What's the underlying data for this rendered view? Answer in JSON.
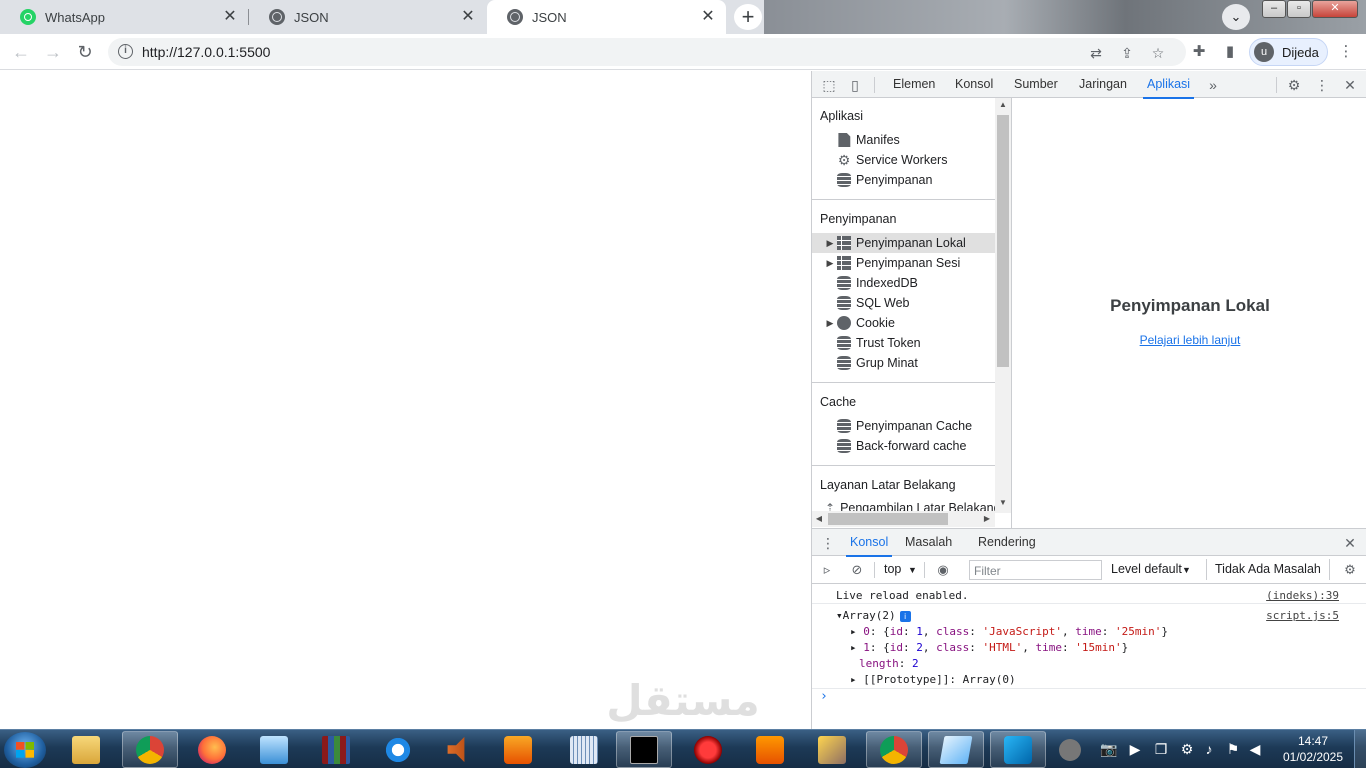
{
  "browser": {
    "tabs": [
      {
        "title": "WhatsApp",
        "favicon": "whatsapp-icon"
      },
      {
        "title": "JSON",
        "favicon": "globe-icon"
      },
      {
        "title": "JSON",
        "favicon": "globe-icon",
        "active": true
      }
    ],
    "url": "http://127.0.0.1:5500",
    "profile_initial": "u",
    "profile_name": "Dijeda"
  },
  "devtools": {
    "tabs": [
      "Elemen",
      "Konsol",
      "Sumber",
      "Jaringan",
      "Aplikasi"
    ],
    "active_tab": "Aplikasi",
    "sidebar": {
      "aplikasi": {
        "heading": "Aplikasi",
        "items": [
          "Manifes",
          "Service Workers",
          "Penyimpanan"
        ]
      },
      "penyimpanan": {
        "heading": "Penyimpanan",
        "items": [
          "Penyimpanan Lokal",
          "Penyimpanan Sesi",
          "IndexedDB",
          "SQL Web",
          "Cookie",
          "Trust Token",
          "Grup Minat"
        ]
      },
      "cache": {
        "heading": "Cache",
        "items": [
          "Penyimpanan Cache",
          "Back-forward cache"
        ]
      },
      "layanan": {
        "heading": "Layanan Latar Belakang",
        "items": [
          "Pengambilan Latar Belakang"
        ]
      }
    },
    "main": {
      "title": "Penyimpanan Lokal",
      "link": "Pelajari lebih lanjut"
    },
    "drawer": {
      "tabs": [
        "Konsol",
        "Masalah",
        "Rendering"
      ],
      "active_tab": "Konsol",
      "context": "top",
      "filter_placeholder": "Filter",
      "level": "Level default",
      "issues": "Tidak Ada Masalah",
      "messages": {
        "live_reload": "Live reload enabled.",
        "live_reload_src": "(indeks):39",
        "array_head": "Array(2)",
        "array_src": "script.js:5",
        "item0_index": "0",
        "item0_id": "1",
        "item0_class": "'JavaScript'",
        "item0_time": "'25min'",
        "item1_index": "1",
        "item1_id": "2",
        "item1_class": "'HTML'",
        "item1_time": "'15min'",
        "length_key": "length",
        "length_val": "2",
        "proto": "[[Prototype]]: Array(0)"
      }
    }
  },
  "taskbar": {
    "apps": [
      "windows-explorer",
      "chrome",
      "firefox",
      "control-panel",
      "winrar",
      "internet-explorer",
      "speaker",
      "media-player",
      "keyboard",
      "cmd",
      "record",
      "sublime-text",
      "tools",
      "chrome",
      "notepad",
      "vscode",
      "app"
    ],
    "time": "14:47",
    "date": "01/02/2025"
  }
}
